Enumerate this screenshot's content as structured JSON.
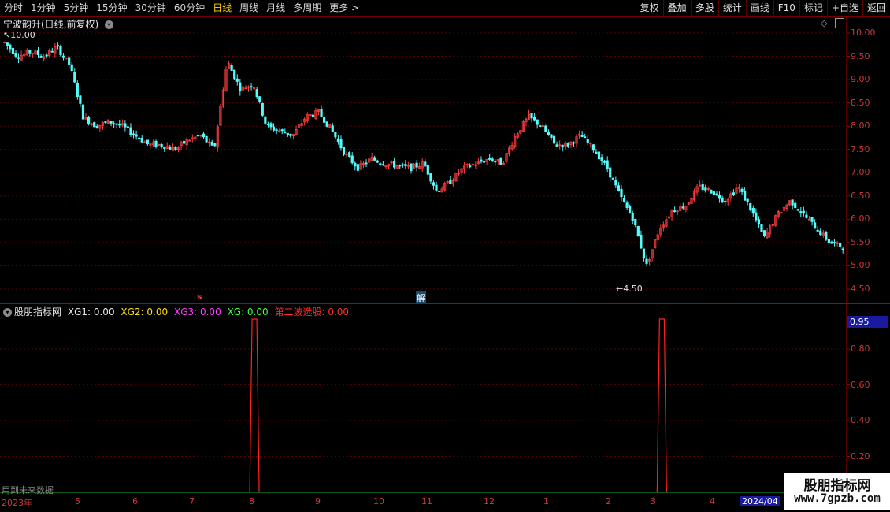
{
  "toolbar": {
    "periods": [
      "分时",
      "1分钟",
      "5分钟",
      "15分钟",
      "30分钟",
      "60分钟",
      "日线",
      "周线",
      "月线",
      "多周期",
      "更多 >"
    ],
    "active_period": "日线",
    "actions": [
      "复权",
      "叠加",
      "多股",
      "统计",
      "画线",
      "F10",
      "标记",
      "+自选",
      "返回"
    ]
  },
  "main_chart": {
    "title": "宁波韵升(日线,前复权)",
    "high_label": "10.00",
    "low_label": "4.50",
    "marker_s": "s",
    "marker_jie": "解",
    "y_ticks": [
      "10.00",
      "9.50",
      "9.00",
      "8.50",
      "8.00",
      "7.50",
      "7.00",
      "6.50",
      "6.00",
      "5.50",
      "5.00",
      "4.50"
    ]
  },
  "sub_chart": {
    "indicator_name": "股朋指标网",
    "xg1": "XG1: 0.00",
    "xg2": "XG2: 0.00",
    "xg3": "XG3: 0.00",
    "xg": "XG: 0.00",
    "second_wave_label": "第二波选股:",
    "second_wave_value": "0.00",
    "current_value": "0.95",
    "y_ticks": [
      "0.80",
      "0.60",
      "0.40",
      "0.20"
    ],
    "footer_note": "用到未来数据"
  },
  "x_axis": {
    "labels": [
      "2023年",
      "5",
      "6",
      "7",
      "8",
      "9",
      "10",
      "11",
      "12",
      "1",
      "2",
      "3",
      "4",
      "2024/04"
    ]
  },
  "watermark": {
    "line1": "股朋指标网",
    "line2": "www.7gpzb.com"
  },
  "colors": {
    "up": "#ff3c3c",
    "down": "#54fcfc",
    "axis": "#b00000",
    "grid": "#5a0000",
    "active": "#ffd200"
  },
  "chart_data": [
    {
      "type": "candlestick",
      "title": "宁波韵升(日线,前复权)",
      "ylim": [
        4.5,
        10.0
      ],
      "x_months": [
        "2023年",
        "5",
        "6",
        "7",
        "8",
        "9",
        "10",
        "11",
        "12",
        "1",
        "2",
        "3",
        "4"
      ],
      "close_trend": [
        9.8,
        9.5,
        9.6,
        9.5,
        9.7,
        9.3,
        8.2,
        8.0,
        8.1,
        8.0,
        7.8,
        7.6,
        7.6,
        7.5,
        7.7,
        7.8,
        7.5,
        9.4,
        8.8,
        8.9,
        8.0,
        7.9,
        7.8,
        8.2,
        8.3,
        7.9,
        7.4,
        7.1,
        7.3,
        7.2,
        7.15,
        7.1,
        7.2,
        6.6,
        6.8,
        7.1,
        7.2,
        7.3,
        7.2,
        7.8,
        8.2,
        8.0,
        7.6,
        7.6,
        7.8,
        7.5,
        7.1,
        6.5,
        6.0,
        5.0,
        5.8,
        6.2,
        6.3,
        6.7,
        6.6,
        6.4,
        6.7,
        6.2,
        5.6,
        6.1,
        6.4,
        6.1,
        5.8,
        5.5,
        5.4
      ],
      "marks": {
        "high": 10.0,
        "low": 4.5
      }
    },
    {
      "type": "line",
      "title": "股朋指标网",
      "ylim": [
        0,
        0.95
      ],
      "series": [
        {
          "name": "第二波选股",
          "spikes_at_index": [
            19,
            50
          ],
          "peak": 1.0,
          "baseline": 0.0
        }
      ]
    }
  ]
}
